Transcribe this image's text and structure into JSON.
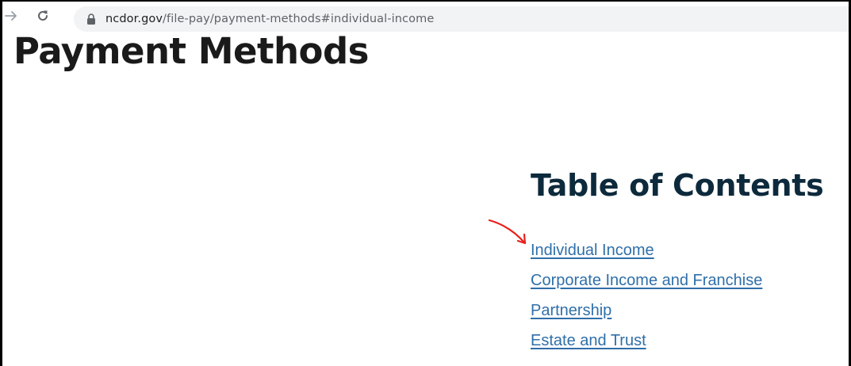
{
  "browser": {
    "url_host": "ncdor.gov",
    "url_path": "/file-pay/payment-methods#individual-income",
    "back_icon": "arrow-right-icon",
    "reload_icon": "reload-icon",
    "lock_icon": "lock-icon"
  },
  "page": {
    "title": "Payment Methods"
  },
  "toc": {
    "heading": "Table of Contents",
    "items": [
      {
        "label": "Individual Income"
      },
      {
        "label": "Corporate Income and Franchise"
      },
      {
        "label": "Partnership"
      },
      {
        "label": "Estate and Trust"
      }
    ]
  },
  "annotation": {
    "color": "#e8201d",
    "icon": "red-arrow-annotation"
  },
  "colors": {
    "link": "#2f6fa9",
    "heading": "#0d2a3c",
    "title": "#1a1a1a"
  }
}
